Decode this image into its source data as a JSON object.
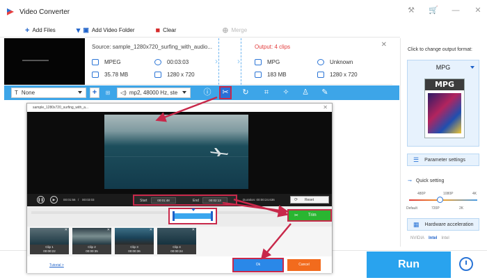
{
  "window": {
    "title": "Video Converter"
  },
  "toolbar": {
    "add_files": "Add Files",
    "add_folder": "Add Video Folder",
    "clear": "Clear",
    "merge": "Merge"
  },
  "file": {
    "source_title": "Source: sample_1280x720_surfing_with_audio...",
    "output_title": "Output: 4 clips",
    "source": {
      "format": "MPEG",
      "duration": "00:03:03",
      "size": "35.78 MB",
      "resolution": "1280 x 720"
    },
    "output": {
      "format": "MPG",
      "duration": "Unknown",
      "size": "183 MB",
      "resolution": "1280 x 720"
    }
  },
  "edit_bar": {
    "subtitle": "None",
    "audio": "mp2, 48000 Hz, ste"
  },
  "right_panel": {
    "change_format_label": "Click to change output format:",
    "format": "MPG",
    "format_icon_text": "MPG",
    "parameter_settings": "Parameter settings",
    "quick_setting": "Quick setting",
    "quality_top": [
      "480P",
      "1080P",
      "4K"
    ],
    "quality_bottom": [
      "Default",
      "720P",
      "2K"
    ],
    "quality_level": 0.45,
    "hardware_acceleration": "Hardware acceleration",
    "vendors": [
      "NVIDIA",
      "Intel",
      "Intel"
    ]
  },
  "run": {
    "label": "Run"
  },
  "dialog": {
    "title": "sample_1280x720_surfing_with_a...",
    "current_time": "00:01:56",
    "total_time": "00:03:03",
    "time_separator": "/",
    "start_label": "Start",
    "start_value": "00:01:48",
    "end_label": "End",
    "end_value": "00:02:13",
    "duration_label": "Duration:",
    "duration_value": "00:00:24.636",
    "reset": "Reset",
    "trim": "Trim",
    "clips": [
      {
        "name": "Clip 1",
        "duration": "00:00:22"
      },
      {
        "name": "Clip 2",
        "duration": "00:00:35"
      },
      {
        "name": "Clip 3",
        "duration": "00:00:36"
      },
      {
        "name": "Clip 4",
        "duration": "00:00:24"
      }
    ],
    "tutorial": "Tutorial >",
    "ok": "Ok",
    "cancel": "Cancel"
  },
  "colors": {
    "accent_blue": "#3da5e8",
    "run_blue": "#29a3ee",
    "highlight_red": "#c8284a",
    "trim_green": "#2ab531",
    "cancel_orange": "#f26b1d",
    "output_red": "#e23a3a"
  }
}
